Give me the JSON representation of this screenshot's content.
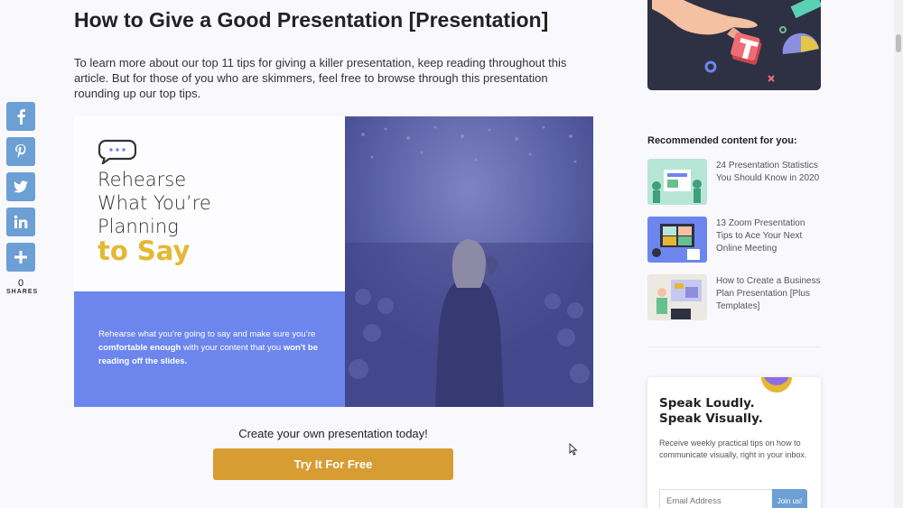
{
  "share": {
    "buttons": [
      {
        "name": "facebook",
        "icon": "facebook-icon",
        "glyph": "f"
      },
      {
        "name": "pinterest",
        "icon": "pinterest-icon",
        "glyph": "P"
      },
      {
        "name": "twitter",
        "icon": "twitter-icon",
        "glyph": "t"
      },
      {
        "name": "linkedin",
        "icon": "linkedin-icon",
        "glyph": "in"
      },
      {
        "name": "more",
        "icon": "plus-icon",
        "glyph": "+"
      }
    ],
    "count": "0",
    "label": "SHARES"
  },
  "article": {
    "title": "How to Give a Good Presentation [Presentation]",
    "intro": "To learn more about our top 11 tips for giving a killer presentation, keep reading throughout this article. But for those of you who are skimmers, feel free to browse through this presentation rounding up our top tips.",
    "slide": {
      "heading_line1": "Rehearse",
      "heading_line2": "What You’re",
      "heading_line3": "Planning",
      "heading_highlight": "to Say",
      "sub_part1": "Rehearse what you’re going to say and make sure you’re ",
      "sub_bold1": "comfortable enough",
      "sub_part2": " with your content that you ",
      "sub_bold2": "won't be reading off the slides."
    },
    "cta_text": "Create your own presentation today!",
    "cta_button": "Try It For Free"
  },
  "sidebar": {
    "recommended_title": "Recommended content for you:",
    "items": [
      {
        "title": "24 Presentation Statistics You Should Know in 2020"
      },
      {
        "title": "13 Zoom Presentation Tips to Ace Your Next Online Meeting"
      },
      {
        "title": "How to Create a Business Plan Presentation [Plus Templates]"
      }
    ],
    "newsletter": {
      "title_line1": "Speak Loudly.",
      "title_line2": "Speak Visually.",
      "description": "Receive weekly practical tips on how to communicate visually, right in your inbox.",
      "email_placeholder": "Email Address",
      "join_label": "Join us!"
    }
  },
  "colors": {
    "accent_blue": "#6c9fd4",
    "slide_blue": "#6c86ee",
    "highlight_yellow": "#e4b834",
    "cta_orange": "#d79d33"
  }
}
